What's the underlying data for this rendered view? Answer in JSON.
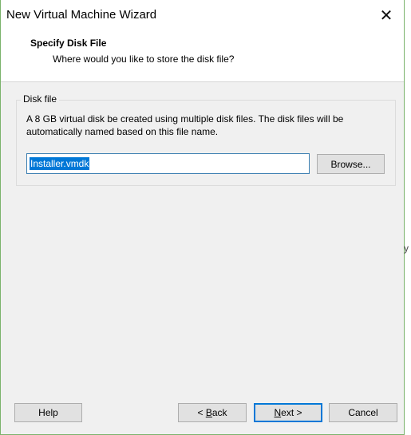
{
  "window": {
    "title": "New Virtual Machine Wizard",
    "close_symbol": "✕"
  },
  "header": {
    "title": "Specify Disk File",
    "subtitle": "Where would you like to store the disk file?"
  },
  "disk_file": {
    "group_label": "Disk file",
    "description": "A 8 GB virtual disk be created using multiple disk files. The disk files will be automatically named based on this file name.",
    "filename_value": "Installer.vmdk",
    "browse_label": "Browse..."
  },
  "footer": {
    "help_label": "Help",
    "back_prefix": "< ",
    "back_accel": "B",
    "back_rest": "ack",
    "next_accel": "N",
    "next_rest": "ext >",
    "cancel_label": "Cancel"
  },
  "background_fragment": "y"
}
